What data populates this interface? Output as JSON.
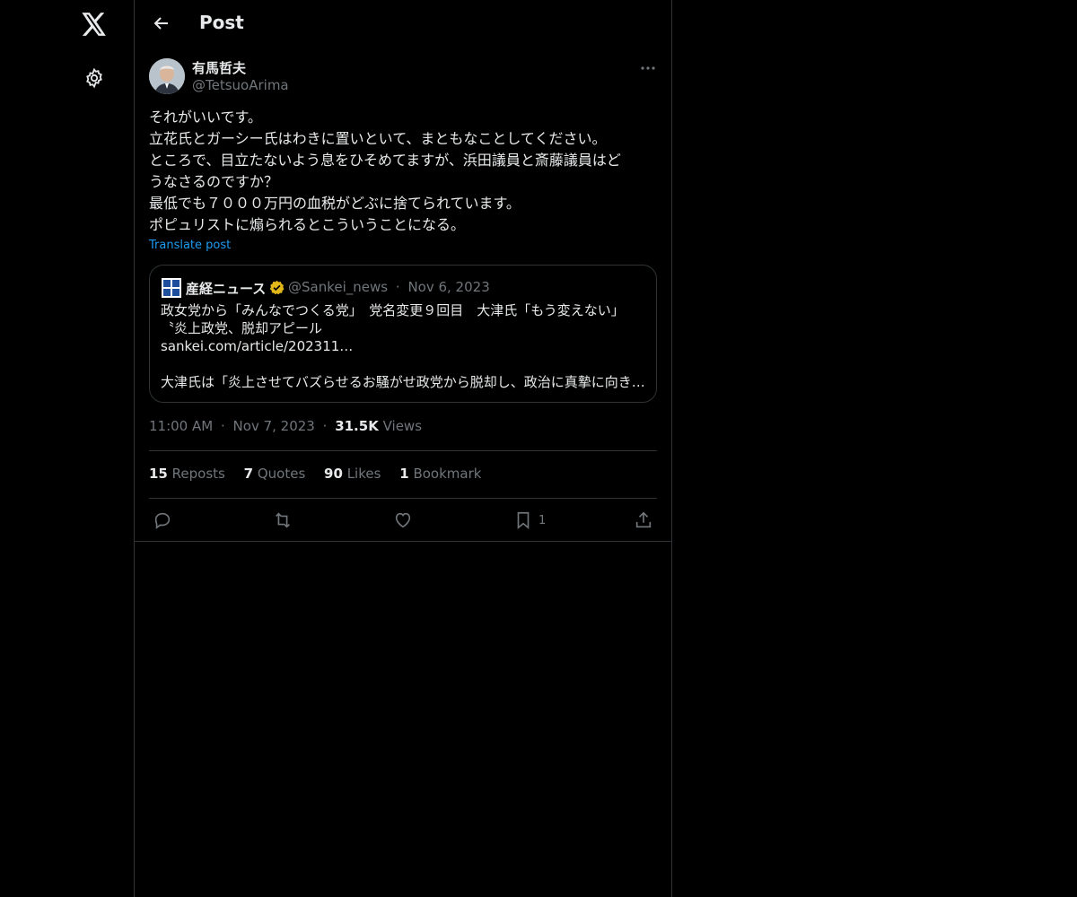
{
  "nav": {
    "logo_icon": "x-logo-icon",
    "settings_icon": "gear-icon"
  },
  "header": {
    "back_icon": "arrow-left-icon",
    "title": "Post"
  },
  "post": {
    "author_name": "有馬哲夫",
    "author_handle": "@TetsuoArima",
    "text": "それがいいです。\n立花氏とガーシー氏はわきに置いといて、まともなことしてください。\nところで、目立たないよう息をひそめてますが、浜田議員と斎藤議員はど\nうなさるのですか？\n最低でも７０００万円の血税がどぶに捨てられています。\nポピュリストに煽られるとこういうことになる。",
    "translate_label": "Translate post",
    "quote": {
      "name": "産経ニュース",
      "handle": "@Sankei_news",
      "separator": "·",
      "date": "Nov 6, 2023",
      "lines": [
        "政女党から「みんなでつくる党」　党名変更９回目　大津氏「もう変えない」",
        "〝炎上政党、脱却アピール",
        "sankei.com/article/202311…",
        "",
        "大津氏は「炎上させてバズらせるお騒がせ政党から脱却し、政治に真摯に向き合う"
      ]
    },
    "time": "11:00 AM",
    "dot": "·",
    "date": "Nov 7, 2023",
    "views_count": "31.5K",
    "views_label": "Views",
    "stats": {
      "reposts_count": "15",
      "reposts_label": "Reposts",
      "quotes_count": "7",
      "quotes_label": "Quotes",
      "likes_count": "90",
      "likes_label": "Likes",
      "bookmarks_count": "1",
      "bookmarks_label": "Bookmark"
    },
    "actions": {
      "reply_icon": "reply-icon",
      "repost_icon": "repost-icon",
      "like_icon": "heart-icon",
      "bookmark_icon": "bookmark-icon",
      "bookmark_count": "1",
      "share_icon": "share-icon"
    }
  },
  "colors": {
    "background": "#000000",
    "text": "#e7e9ea",
    "muted": "#71767b",
    "link": "#1d9bf0",
    "border": "#2f3336",
    "verified": "#e2b719"
  }
}
